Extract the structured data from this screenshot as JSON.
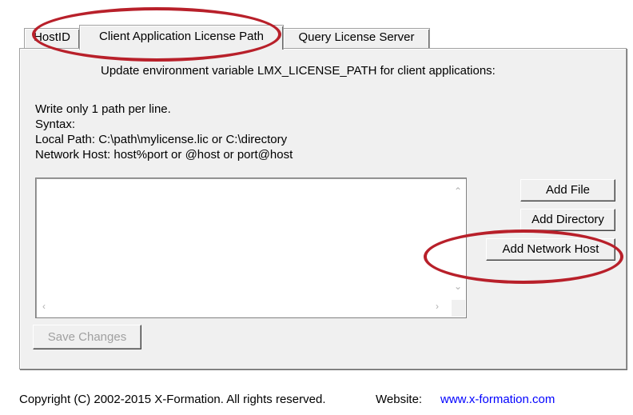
{
  "tabs": [
    {
      "label": "HostID"
    },
    {
      "label": "Client Application License Path"
    },
    {
      "label": "Query License Server"
    }
  ],
  "panel": {
    "heading": "Update environment variable LMX_LICENSE_PATH for client applications:",
    "instructions": [
      "Write only 1 path per line.",
      "Syntax:",
      "Local Path: C:\\path\\mylicense.lic or C:\\directory",
      "Network Host: host%port or @host or port@host"
    ]
  },
  "buttons": {
    "add_file": "Add File",
    "add_directory": "Add Directory",
    "add_network_host": "Add Network Host",
    "save_changes": "Save Changes"
  },
  "footer": {
    "copyright": "Copyright (C) 2002-2015 X-Formation. All rights reserved.",
    "website_label": "Website:",
    "website_link": "www.x-formation.com"
  },
  "colors": {
    "annotation": "#b8202a",
    "link": "#0000ff",
    "panel_bg": "#f0f0f0"
  }
}
